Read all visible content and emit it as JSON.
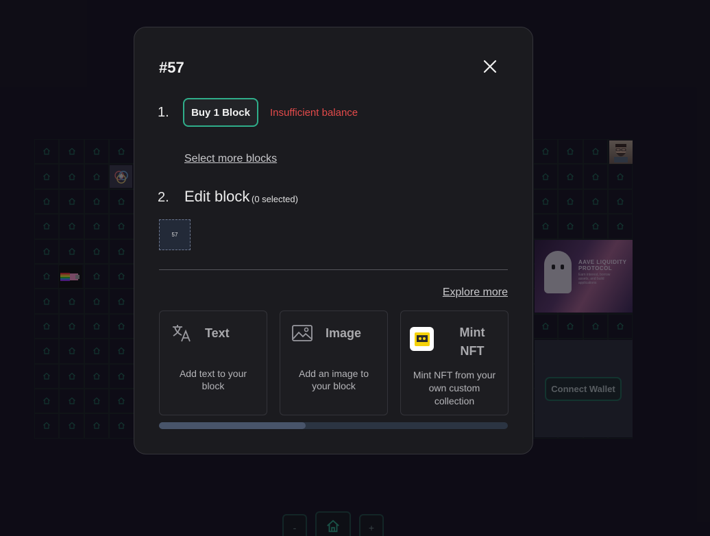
{
  "modal": {
    "title": "#57",
    "step1_number": "1.",
    "buy_button_label": "Buy 1 Block",
    "error_text": "Insufficient balance",
    "select_more_link": "Select more blocks",
    "step2_number": "2.",
    "edit_title": "Edit block",
    "edit_subtitle": "(0 selected)",
    "selected_block_label": "57",
    "explore_more_link": "Explore more",
    "cards": [
      {
        "title": "Text",
        "description": "Add text to your block",
        "icon": "translate-icon"
      },
      {
        "title": "Image",
        "description": "Add an image to your block",
        "icon": "image-icon"
      },
      {
        "title": "Mint NFT",
        "description": "Mint NFT from your own custom collection",
        "icon": "nft-collection-icon"
      }
    ],
    "scroll_progress": 0.42
  },
  "background": {
    "connect_wallet_label": "Connect Wallet",
    "aave_banner_title": "AAVE LIQUIDITY PROTOCOL",
    "aave_banner_sub": "Earn interest, borrow assets, and build applications",
    "zoom_out_label": "-",
    "zoom_in_label": "+"
  },
  "colors": {
    "accent": "#2fae8a",
    "error": "#e34a4a",
    "modal_bg": "#1b1b1f"
  }
}
